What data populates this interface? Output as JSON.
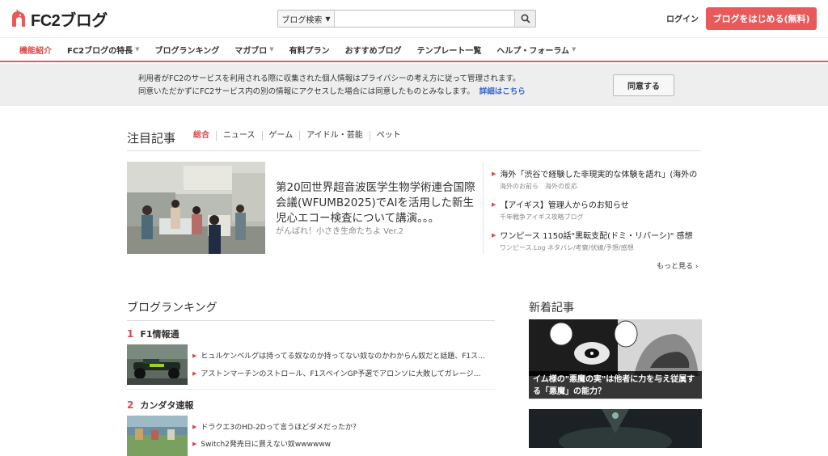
{
  "header": {
    "logo_text": "FC2ブログ",
    "search_select": "ブログ検索",
    "search_value": "",
    "login": "ログイン",
    "start_button": "ブログをはじめる(無料)"
  },
  "nav": {
    "items": [
      {
        "label": "機能紹介",
        "active": true,
        "dropdown": false
      },
      {
        "label": "FC2ブログの特長",
        "active": false,
        "dropdown": true
      },
      {
        "label": "ブログランキング",
        "active": false,
        "dropdown": false
      },
      {
        "label": "マガブロ",
        "active": false,
        "dropdown": true
      },
      {
        "label": "有料プラン",
        "active": false,
        "dropdown": false
      },
      {
        "label": "おすすめブログ",
        "active": false,
        "dropdown": false
      },
      {
        "label": "テンプレート一覧",
        "active": false,
        "dropdown": false
      },
      {
        "label": "ヘルプ・フォーラム",
        "active": false,
        "dropdown": true
      }
    ]
  },
  "consent": {
    "line1": "利用者がFC2のサービスを利用される際に収集された個人情報はプライバシーの考え方に従って管理されます。",
    "line2": "同意いただかずにFC2サービス内の別の情報にアクセスした場合には同意したものとみなします。",
    "link": "詳細はこちら",
    "agree_button": "同意する"
  },
  "featured": {
    "title": "注目記事",
    "tabs": [
      "総合",
      "ニュース",
      "ゲーム",
      "アイドル・芸能",
      "ペット"
    ],
    "main_title": "第20回世界超音波医学生物学術連合国際会議(WFUMB2025)でAIを活用した新生児心エコー検査について講演。。。",
    "main_source": "がんばれ！小さき生命たちよ Ver.2",
    "side": [
      {
        "title": "海外「渋谷で経験した非現実的な体験を語れ」(海外の",
        "source": "海外のお前ら　海外の反応"
      },
      {
        "title": "【アイギス】管理人からのお知らせ",
        "source": "千年戦争アイギス攻略ブログ"
      },
      {
        "title": "ワンピース 1150話\"黒転支配(ドミ・リバーシ)\" 感想",
        "source": "ワンピース.Log ネタバレ/考察/伏線/予想/感想"
      }
    ],
    "more": "もっと見る"
  },
  "ranking": {
    "title": "ブログランキング",
    "entries": [
      {
        "rank": "1",
        "name": "F1情報通",
        "items": [
          "ヒュルケンベルグは持ってる奴なのか持ってない奴なのかわからん奴だと話題、F1ス…",
          "アストンマーチンのストロール、F1スペインGP予選でアロンソに大敗してガレージ…"
        ]
      },
      {
        "rank": "2",
        "name": "カンダタ速報",
        "items": [
          "ドラクエ3のHD-2Dって言うほどダメだったか？",
          "Switch2発売日に買えない奴wwwwww"
        ]
      }
    ]
  },
  "new_articles": {
    "title": "新着記事",
    "caption1": "イム様の\"悪魔の実\"は他者に力を与え従属する「悪魔」の能力？"
  },
  "colors": {
    "accent": "#e85a5a",
    "link": "#3366cc"
  }
}
